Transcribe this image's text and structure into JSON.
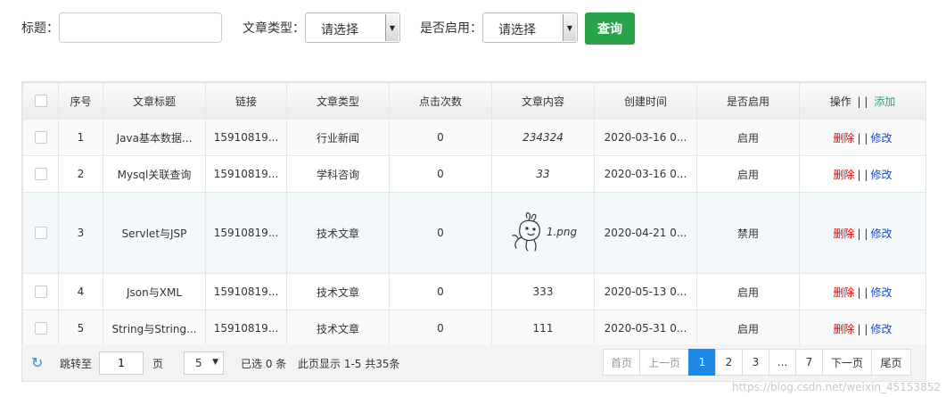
{
  "filters": {
    "title_label": "标题：",
    "title_value": "",
    "type_label": "文章类型：",
    "type_selected": "请选择",
    "enabled_label": "是否启用：",
    "enabled_selected": "请选择",
    "query_label": "查询"
  },
  "table": {
    "headers": {
      "index": "序号",
      "title": "文章标题",
      "link": "链接",
      "type": "文章类型",
      "clicks": "点击次数",
      "content": "文章内容",
      "created": "创建时间",
      "enabled": "是否启用",
      "ops": "操作",
      "separator": "| |",
      "add": "添加"
    },
    "rows": [
      {
        "index": "1",
        "title": "Java基本数据...",
        "link": "15910819...",
        "type": "行业新闻",
        "clicks": "0",
        "content": "234324",
        "created": "2020-03-16 0...",
        "enabled": "启用"
      },
      {
        "index": "2",
        "title": "Mysql关联查询",
        "link": "15910819...",
        "type": "学科咨询",
        "clicks": "0",
        "content": "33",
        "created": "2020-03-16 0...",
        "enabled": "启用"
      },
      {
        "index": "3",
        "title": "Servlet与JSP",
        "link": "15910819...",
        "type": "技术文章",
        "clicks": "0",
        "content": "1.png",
        "created": "2020-04-21 0...",
        "enabled": "禁用"
      },
      {
        "index": "4",
        "title": "Json与XML",
        "link": "15910819...",
        "type": "技术文章",
        "clicks": "0",
        "content": "333",
        "created": "2020-05-13 0...",
        "enabled": "启用"
      },
      {
        "index": "5",
        "title": "String与String...",
        "link": "15910819...",
        "type": "技术文章",
        "clicks": "0",
        "content": "111",
        "created": "2020-05-31 0...",
        "enabled": "启用"
      }
    ],
    "row_actions": {
      "delete": "删除",
      "separator": "| |",
      "edit": "修改"
    }
  },
  "pager": {
    "jump_label": "跳转至",
    "jump_value": "1",
    "page_unit": "页",
    "page_size": "5",
    "selected_text": "已选 0 条",
    "summary": "此页显示 1-5 共35条",
    "first": "首页",
    "prev": "上一页",
    "pages": [
      "1",
      "2",
      "3",
      "...",
      "7"
    ],
    "next": "下一页",
    "last": "尾页"
  },
  "watermark": "https://blog.csdn.net/weixin_45153852",
  "colors": {
    "query_button": "#2aa44a",
    "active_page": "#1e88e5",
    "delete_link": "#e60000",
    "edit_link": "#1a4acb",
    "add_link": "#2a9f8c"
  }
}
